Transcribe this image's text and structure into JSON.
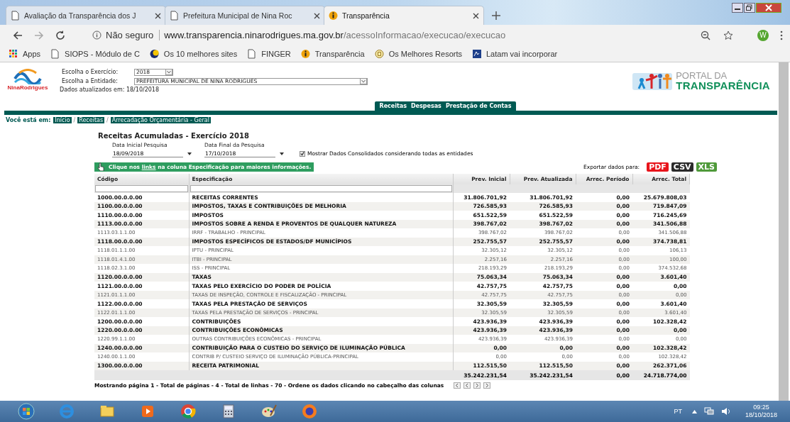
{
  "browser": {
    "tabs": [
      {
        "title": "Avaliação da Transparência dos J",
        "selected": false,
        "kind": "page"
      },
      {
        "title": "Prefeitura Municipal de Nina Roc",
        "selected": false,
        "kind": "page"
      },
      {
        "title": "Transparência",
        "selected": true,
        "kind": "info"
      }
    ],
    "security": "Não seguro",
    "url_host": "www.transparencia.ninarodrigues.ma.gov.br",
    "url_path": "/acessoInformacao/execucao/execucao",
    "profile": "W",
    "bookmarks": [
      {
        "label": "Apps",
        "kind": "apps"
      },
      {
        "label": "SIOPS - Módulo de C",
        "kind": "page"
      },
      {
        "label": "Os 10 melhores sites",
        "kind": "moon"
      },
      {
        "label": "FINGER",
        "kind": "page"
      },
      {
        "label": "Transparência",
        "kind": "info"
      },
      {
        "label": "Os Melhores Resorts",
        "kind": "badge"
      },
      {
        "label": "Latam vai incorporar",
        "kind": "square"
      }
    ]
  },
  "header": {
    "logo_text": "NinaRodrigues",
    "exercicio_label": "Escolha o Exercício:",
    "exercicio": "2018",
    "entidade_label": "Escolha a Entidade:",
    "entidade": "PREFEITURA MUNICIPAL DE NINA RODRIGUES",
    "updated": "Dados atualizados em: 18/10/2018",
    "portal_top": "PORTAL DA",
    "portal_bottom": "TRANSPARÊNCIA"
  },
  "nav": [
    "Receitas",
    "Despesas",
    "Prestação de Contas"
  ],
  "breadcrumb": {
    "label": "Você está em:",
    "items": [
      {
        "kind": "link",
        "text": "Início"
      },
      {
        "kind": "separator",
        "text": "/"
      },
      {
        "kind": "link",
        "text": "Receitas"
      },
      {
        "kind": "separator",
        "text": "/"
      },
      {
        "kind": "link",
        "text": "Arrecadação Orçamentária - Geral"
      }
    ]
  },
  "report": {
    "title": "Receitas Acumuladas - Exercício 2018",
    "start_label": "Data Inicial Pesquisa",
    "start": "18/09/2018",
    "end_label": "Data Final da Pesquisa",
    "end": "17/10/2018",
    "consolidated": {
      "label": "Mostrar Dados Consolidados considerando todas as entidades",
      "checked": true
    },
    "hint": "Clique nos **links** na coluna Especificação para maiores informações.",
    "export_label": "Exportar dados para:",
    "exports": [
      {
        "label": "PDF",
        "color": "#e8141b"
      },
      {
        "label": "CSV",
        "color": "#2b2b2b"
      },
      {
        "label": "XLS",
        "color": "#4f9a3a"
      }
    ]
  },
  "table": {
    "columns": [
      "Código",
      "Especificação",
      "Prev. Inicial",
      "Prev. Atualizada",
      "Arrec. Período",
      "Arrec. Total"
    ],
    "rows": [
      {
        "bold": true,
        "cells": [
          "1000.00.0.0.00",
          "RECEITAS CORRENTES",
          "31.806.701,92",
          "31.806.701,92",
          "0,00",
          "25.679.808,03"
        ]
      },
      {
        "bold": true,
        "cells": [
          "1100.00.0.0.00",
          "IMPOSTOS, TAXAS E CONTRIBUIÇÕES DE MELHORIA",
          "726.585,93",
          "726.585,93",
          "0,00",
          "719.847,09"
        ]
      },
      {
        "bold": true,
        "cells": [
          "1110.00.0.0.00",
          "IMPOSTOS",
          "651.522,59",
          "651.522,59",
          "0,00",
          "716.245,69"
        ]
      },
      {
        "bold": true,
        "cells": [
          "1113.00.0.0.00",
          "IMPOSTOS SOBRE A RENDA E PROVENTOS DE QUALQUER NATUREZA",
          "398.767,02",
          "398.767,02",
          "0,00",
          "341.506,88"
        ]
      },
      {
        "bold": false,
        "cells": [
          "1113.03.1.1.00",
          "IRRF - TRABALHO - PRINCIPAL",
          "398.767,02",
          "398.767,02",
          "0,00",
          "341.506,88"
        ]
      },
      {
        "bold": true,
        "cells": [
          "1118.00.0.0.00",
          "IMPOSTOS ESPECÍFICOS DE ESTADOS/DF MUNICÍPIOS",
          "252.755,57",
          "252.755,57",
          "0,00",
          "374.738,81"
        ]
      },
      {
        "bold": false,
        "cells": [
          "1118.01.1.1.00",
          "IPTU - PRINCIPAL",
          "32.305,12",
          "32.305,12",
          "0,00",
          "106,13"
        ]
      },
      {
        "bold": false,
        "cells": [
          "1118.01.4.1.00",
          "ITBI - PRINCIPAL",
          "2.257,16",
          "2.257,16",
          "0,00",
          "100,00"
        ]
      },
      {
        "bold": false,
        "cells": [
          "1118.02.3.1.00",
          "ISS - PRINCIPAL",
          "218.193,29",
          "218.193,29",
          "0,00",
          "374.532,68"
        ]
      },
      {
        "bold": true,
        "cells": [
          "1120.00.0.0.00",
          "TAXAS",
          "75.063,34",
          "75.063,34",
          "0,00",
          "3.601,40"
        ]
      },
      {
        "bold": true,
        "cells": [
          "1121.00.0.0.00",
          "TAXAS PELO EXERCÍCIO DO PODER DE POLÍCIA",
          "42.757,75",
          "42.757,75",
          "0,00",
          "0,00"
        ]
      },
      {
        "bold": false,
        "cells": [
          "1121.01.1.1.00",
          "TAXAS DE INSPEÇÃO, CONTROLE E FISCALIZAÇÃO - PRINCIPAL",
          "42.757,75",
          "42.757,75",
          "0,00",
          "0,00"
        ]
      },
      {
        "bold": true,
        "cells": [
          "1122.00.0.0.00",
          "TAXAS PELA PRESTAÇÃO DE SERVIÇOS",
          "32.305,59",
          "32.305,59",
          "0,00",
          "3.601,40"
        ]
      },
      {
        "bold": false,
        "cells": [
          "1122.01.1.1.00",
          "TAXAS PELA PRESTAÇÃO DE SERVIÇOS - PRINCIPAL",
          "32.305,59",
          "32.305,59",
          "0,00",
          "3.601,40"
        ]
      },
      {
        "bold": true,
        "cells": [
          "1200.00.0.0.00",
          "CONTRIBUIÇÕES",
          "423.936,39",
          "423.936,39",
          "0,00",
          "102.328,42"
        ]
      },
      {
        "bold": true,
        "cells": [
          "1220.00.0.0.00",
          "CONTRIBUIÇÕES ECONÔMICAS",
          "423.936,39",
          "423.936,39",
          "0,00",
          "0,00"
        ]
      },
      {
        "bold": false,
        "cells": [
          "1220.99.1.1.00",
          "OUTRAS CONTRIBUIÇÕES ECONÔMICAS - PRINCIPAL",
          "423.936,39",
          "423.936,39",
          "0,00",
          "0,00"
        ]
      },
      {
        "bold": true,
        "cells": [
          "1240.00.0.0.00",
          "CONTRIBUIÇÃO PARA O CUSTEIO DO SERVIÇO DE ILUMINAÇÃO PÚBLICA",
          "0,00",
          "0,00",
          "0,00",
          "102.328,42"
        ]
      },
      {
        "bold": false,
        "cells": [
          "1240.00.1.1.00",
          "CONTRIB P/ CUSTEIO SERVIÇO DE ILUMINAÇÃO PÚBLICA-PRINCIPAL",
          "0,00",
          "0,00",
          "0,00",
          "102.328,42"
        ]
      },
      {
        "bold": true,
        "cells": [
          "1300.00.0.0.00",
          "RECEITA PATRIMONIAL",
          "112.515,50",
          "112.515,50",
          "0,00",
          "262.371,06"
        ]
      }
    ],
    "totals": [
      "35.242.231,54",
      "35.242.231,54",
      "0,00",
      "24.718.774,00"
    ],
    "footer": "Mostrando página 1 - Total de páginas - 4 - Total de linhas - 70 - Ordene os dados clicando no cabeçalho das colunas"
  },
  "taskbar": {
    "apps": [
      {
        "kind": "windows"
      },
      {
        "kind": "ie"
      },
      {
        "kind": "explorer"
      },
      {
        "kind": "media"
      },
      {
        "kind": "chrome"
      },
      {
        "kind": "calculator"
      },
      {
        "kind": "paint"
      },
      {
        "kind": "firefox"
      }
    ],
    "language": "PT",
    "time": "09:25",
    "date": "18/10/2018"
  }
}
